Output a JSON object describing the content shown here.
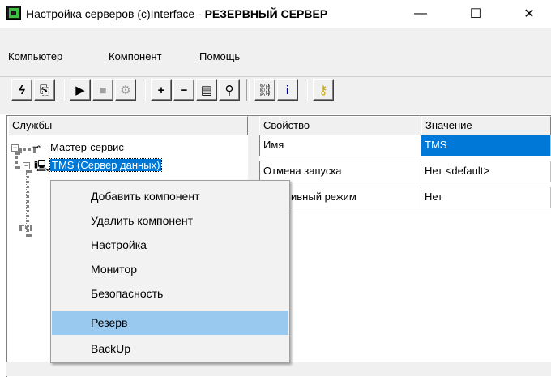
{
  "window": {
    "title_prefix": "Настройка серверов (c)Interface - ",
    "title_bold": "РЕЗЕРВНЫЙ СЕРВЕР",
    "minimize": "—",
    "maximize": "☐",
    "close": "✕"
  },
  "menu": [
    "Компьютер",
    "Компонент",
    "Помощь"
  ],
  "toolbar": {
    "icons": [
      "lightning-icon",
      "export-icon",
      "play-icon",
      "stop-icon",
      "disabled-tool-icon",
      "add-icon",
      "remove-icon",
      "properties-icon",
      "find-icon",
      "network-icon",
      "info-icon",
      "key-icon"
    ]
  },
  "tree": {
    "header": "Службы",
    "root": "Мастер-сервис",
    "child": "TMS (Сервер данных)"
  },
  "properties": {
    "col_name": "Свойство",
    "col_value": "Значение",
    "rows": [
      {
        "name": "Имя",
        "value": "TMS"
      },
      {
        "name": "Отмена запуска",
        "value": "Нет <default>"
      },
      {
        "name": "ивный режим",
        "value": "Нет"
      }
    ]
  },
  "context_menu": {
    "items": [
      "Добавить компонент",
      "Удалить компонент",
      "Настройка",
      "Монитор",
      "Безопасность",
      "Резерв",
      "BackUp"
    ],
    "highlighted_index": 5
  },
  "colors": {
    "selection": "#0078d7",
    "menu_highlight": "#99c9ef"
  }
}
